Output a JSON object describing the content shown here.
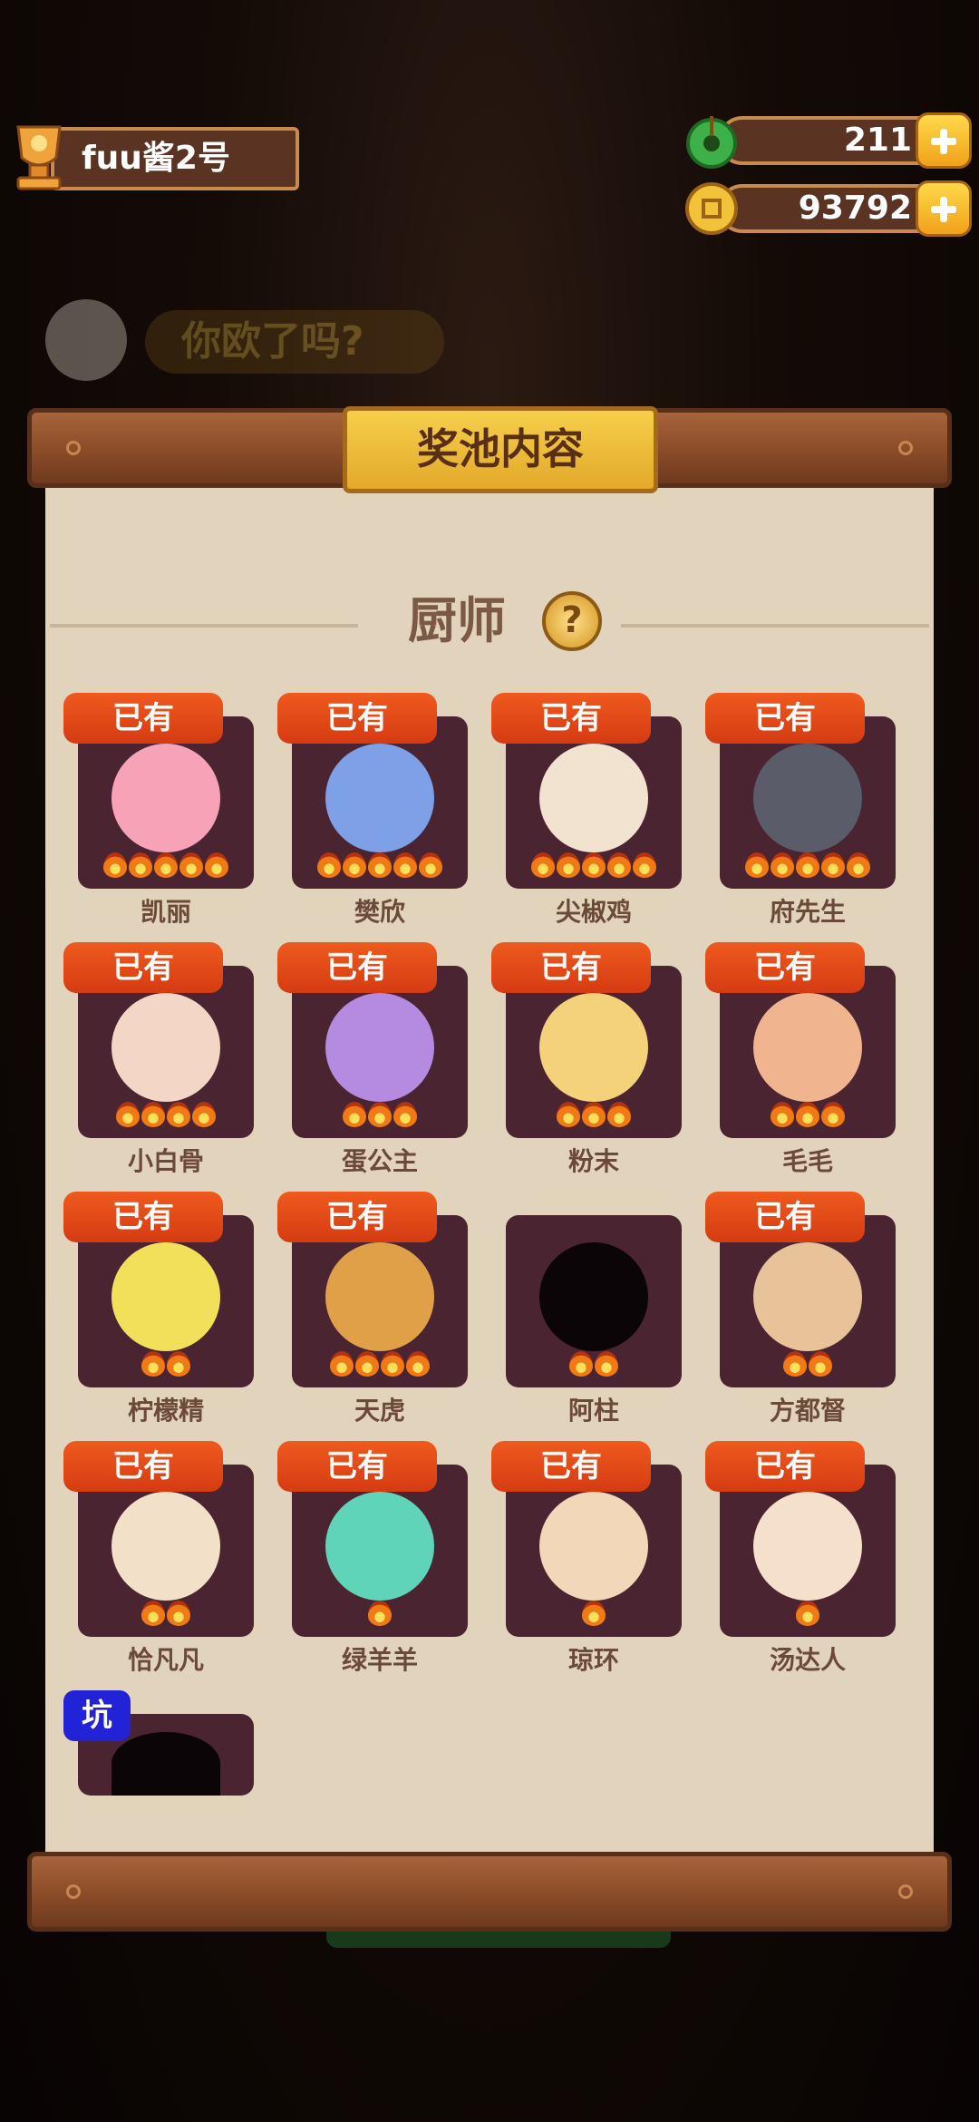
{
  "player": {
    "name": "fuu酱2号"
  },
  "resources": {
    "jade": "211",
    "coins": "93792"
  },
  "background": {
    "banner_text": "你欧了吗?"
  },
  "panel": {
    "title": "奖池内容",
    "section": "厨师",
    "help": "?"
  },
  "owned_label": "已有",
  "chefs": [
    {
      "name": "凯丽",
      "owned": true,
      "stars": 5,
      "color": "#f6a3b7"
    },
    {
      "name": "樊欣",
      "owned": true,
      "stars": 5,
      "color": "#7ea0e6"
    },
    {
      "name": "尖椒鸡",
      "owned": true,
      "stars": 5,
      "color": "#f1e3cf"
    },
    {
      "name": "府先生",
      "owned": true,
      "stars": 5,
      "color": "#5a5c6a"
    },
    {
      "name": "小白骨",
      "owned": true,
      "stars": 4,
      "color": "#f3d6c6"
    },
    {
      "name": "蛋公主",
      "owned": true,
      "stars": 3,
      "color": "#b48be0"
    },
    {
      "name": "粉末",
      "owned": true,
      "stars": 3,
      "color": "#f4d27a"
    },
    {
      "name": "毛毛",
      "owned": true,
      "stars": 3,
      "color": "#f0b58e"
    },
    {
      "name": "柠檬精",
      "owned": true,
      "stars": 2,
      "color": "#f3e05a"
    },
    {
      "name": "天虎",
      "owned": true,
      "stars": 4,
      "color": "#e0a047"
    },
    {
      "name": "阿柱",
      "owned": false,
      "stars": 2,
      "color": "#0b0508"
    },
    {
      "name": "方都督",
      "owned": true,
      "stars": 2,
      "color": "#e8c39a"
    },
    {
      "name": "恰凡凡",
      "owned": true,
      "stars": 2,
      "color": "#f3e0c8"
    },
    {
      "name": "绿羊羊",
      "owned": true,
      "stars": 1,
      "color": "#5fd4b8"
    },
    {
      "name": "琼环",
      "owned": true,
      "stars": 1,
      "color": "#f2d7b8"
    },
    {
      "name": "汤达人",
      "owned": true,
      "stars": 1,
      "color": "#f5e0cc"
    }
  ],
  "pit": {
    "label": "坑"
  }
}
